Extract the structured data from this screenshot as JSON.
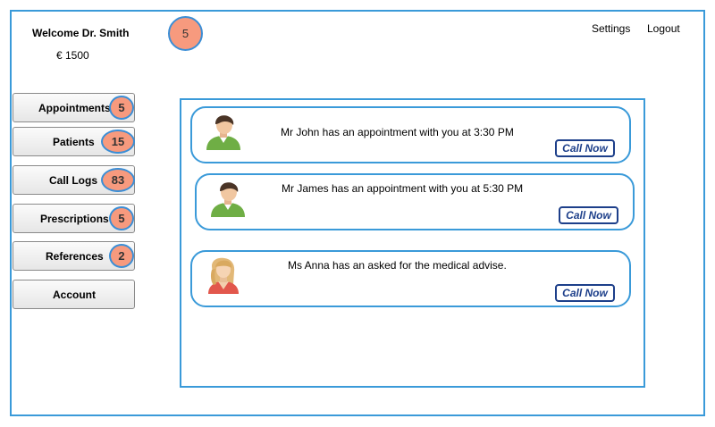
{
  "header": {
    "welcome": "Welcome Dr. Smith",
    "balance": "€ 1500",
    "notification_count": "5",
    "settings_label": "Settings",
    "logout_label": "Logout"
  },
  "sidebar": {
    "items": [
      {
        "label": "Appointments",
        "count": "5"
      },
      {
        "label": "Patients",
        "count": "15"
      },
      {
        "label": "Call Logs",
        "count": "83"
      },
      {
        "label": "Prescriptions",
        "count": "5"
      },
      {
        "label": "References",
        "count": "2"
      },
      {
        "label": "Account",
        "count": ""
      }
    ]
  },
  "notifications": [
    {
      "message": "Mr John has an appointment with you at 3:30 PM",
      "action": "Call Now",
      "avatar": "male-patient-icon"
    },
    {
      "message": "Mr James has an appointment with you at 5:30 PM",
      "action": "Call Now",
      "avatar": "male-patient-icon"
    },
    {
      "message": "Ms Anna has an asked for the medical advise.",
      "action": "Call Now",
      "avatar": "female-patient-icon"
    }
  ],
  "colors": {
    "accent_border": "#3a9ad9",
    "badge_fill": "#f79a7e",
    "call_button": "#1d3f8a"
  }
}
